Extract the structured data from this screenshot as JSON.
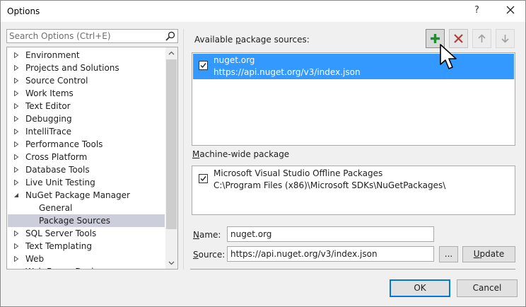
{
  "window": {
    "title": "Options",
    "help_label": "?"
  },
  "search": {
    "placeholder": "Search Options (Ctrl+E)",
    "value": ""
  },
  "tree": {
    "items": [
      {
        "label": "Environment",
        "expandable": true,
        "expanded": false,
        "child": false,
        "selected": false
      },
      {
        "label": "Projects and Solutions",
        "expandable": true,
        "expanded": false,
        "child": false,
        "selected": false
      },
      {
        "label": "Source Control",
        "expandable": true,
        "expanded": false,
        "child": false,
        "selected": false
      },
      {
        "label": "Work Items",
        "expandable": true,
        "expanded": false,
        "child": false,
        "selected": false
      },
      {
        "label": "Text Editor",
        "expandable": true,
        "expanded": false,
        "child": false,
        "selected": false
      },
      {
        "label": "Debugging",
        "expandable": true,
        "expanded": false,
        "child": false,
        "selected": false
      },
      {
        "label": "IntelliTrace",
        "expandable": true,
        "expanded": false,
        "child": false,
        "selected": false
      },
      {
        "label": "Performance Tools",
        "expandable": true,
        "expanded": false,
        "child": false,
        "selected": false
      },
      {
        "label": "Cross Platform",
        "expandable": true,
        "expanded": false,
        "child": false,
        "selected": false
      },
      {
        "label": "Database Tools",
        "expandable": true,
        "expanded": false,
        "child": false,
        "selected": false
      },
      {
        "label": "Live Unit Testing",
        "expandable": true,
        "expanded": false,
        "child": false,
        "selected": false
      },
      {
        "label": "NuGet Package Manager",
        "expandable": true,
        "expanded": true,
        "child": false,
        "selected": false
      },
      {
        "label": "General",
        "expandable": false,
        "expanded": false,
        "child": true,
        "selected": false
      },
      {
        "label": "Package Sources",
        "expandable": false,
        "expanded": false,
        "child": true,
        "selected": true
      },
      {
        "label": "SQL Server Tools",
        "expandable": true,
        "expanded": false,
        "child": false,
        "selected": false
      },
      {
        "label": "Text Templating",
        "expandable": true,
        "expanded": false,
        "child": false,
        "selected": false
      },
      {
        "label": "Web",
        "expandable": true,
        "expanded": false,
        "child": false,
        "selected": false
      },
      {
        "label": "Web Forms Designer",
        "expandable": true,
        "expanded": false,
        "child": false,
        "selected": false
      }
    ]
  },
  "sources": {
    "heading_pre": "Available ",
    "heading_key": "p",
    "heading_post": "ackage sources:",
    "items": [
      {
        "name": "nuget.org",
        "url": "https://api.nuget.org/v3/index.json",
        "checked": true
      }
    ]
  },
  "machine_wide": {
    "heading_key": "M",
    "heading_post": "achine-wide package",
    "items": [
      {
        "name": "Microsoft Visual Studio Offline Packages",
        "url": "C:\\Program Files (x86)\\Microsoft SDKs\\NuGetPackages\\",
        "checked": true
      }
    ]
  },
  "form": {
    "name_key": "N",
    "name_post": "ame:",
    "name_value": "nuget.org",
    "source_key": "S",
    "source_post": "ource:",
    "source_value": "https://api.nuget.org/v3/index.json",
    "browse_label": "...",
    "update_key": "U",
    "update_post": "pdate"
  },
  "buttons": {
    "ok": "OK",
    "cancel": "Cancel"
  },
  "colors": {
    "selection": "#3399ff",
    "tree_selection": "#cccedb",
    "add_icon": "#1f8c2e",
    "remove_icon": "#c0392b",
    "accent": "#0078d7"
  },
  "icons": {
    "add": "plus-icon",
    "remove": "x-icon",
    "move_up": "arrow-up-icon",
    "move_down": "arrow-down-icon"
  }
}
